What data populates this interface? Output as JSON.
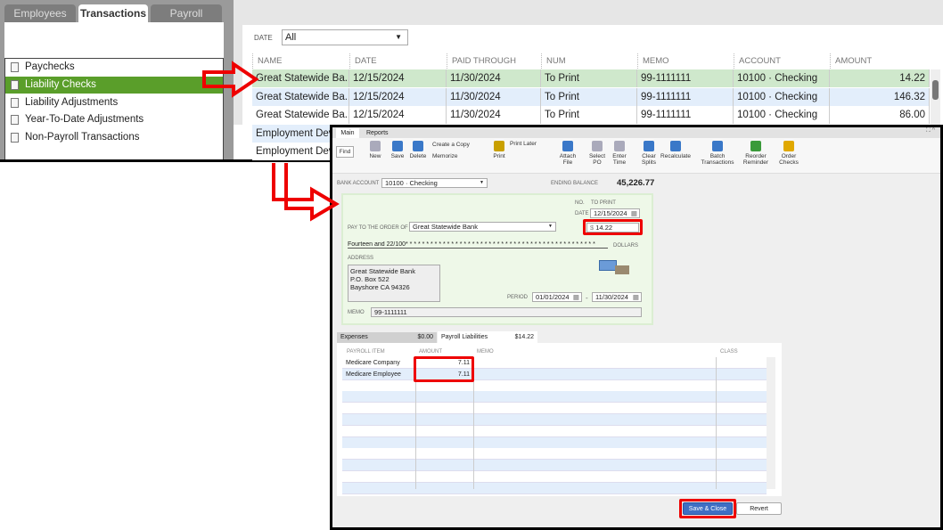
{
  "left": {
    "tabs": [
      "Employees",
      "Transactions",
      "Payroll"
    ],
    "items": [
      "Paychecks",
      "Liability Checks",
      "Liability Adjustments",
      "Year-To-Date Adjustments",
      "Non-Payroll Transactions"
    ]
  },
  "filter": {
    "label": "DATE",
    "value": "All"
  },
  "table": {
    "headers": [
      "NAME",
      "DATE",
      "PAID THROUGH",
      "NUM",
      "MEMO",
      "ACCOUNT",
      "AMOUNT"
    ],
    "rows": [
      [
        "Great Statewide Ba...",
        "12/15/2024",
        "11/30/2024",
        "To Print",
        "99-1111111",
        "10100 · Checking",
        "14.22"
      ],
      [
        "Great Statewide Ba...",
        "12/15/2024",
        "11/30/2024",
        "To Print",
        "99-1111111",
        "10100 · Checking",
        "146.32"
      ],
      [
        "Great Statewide Ba...",
        "12/15/2024",
        "11/30/2024",
        "To Print",
        "99-1111111",
        "10100 · Checking",
        "86.00"
      ],
      [
        "Employment Dev..."
      ],
      [
        "Employment Dev..."
      ]
    ]
  },
  "window": {
    "tabs": [
      "Main",
      "Reports"
    ],
    "toolbar": [
      "Find",
      "New",
      "Save",
      "Delete",
      "Create a Copy",
      "Memorize",
      "Print",
      "Print Later",
      "Attach File",
      "Select PO",
      "Enter Time",
      "Clear Splits",
      "Recalculate",
      "Batch Transactions",
      "Reorder Reminder",
      "Order Checks"
    ],
    "bank_account_label": "BANK ACCOUNT",
    "bank_account": "10100 · Checking",
    "ending_balance_label": "ENDING BALANCE",
    "ending_balance": "45,226.77",
    "check": {
      "no_label": "NO.",
      "no": "TO PRINT",
      "date_label": "DATE",
      "date": "12/15/2024",
      "payee_label": "PAY TO THE ORDER OF",
      "payee": "Great Statewide Bank",
      "currency": "$",
      "amount": "14.22",
      "words": "Fourteen and 22/100* * * * * * * * * * * * * * * * * * * * * * * * * * * * * * * * * * * * * * * * * * * * * *",
      "dollars": "DOLLARS",
      "address_label": "ADDRESS",
      "address": [
        "Great Statewide Bank",
        "P.O. Box 522",
        "Bayshore CA 94326"
      ],
      "period_label": "PERIOD",
      "period_from": "01/01/2024",
      "period_sep": "-",
      "period_to": "11/30/2024",
      "memo_label": "MEMO",
      "memo": "99-1111111"
    },
    "subtabs": [
      {
        "label": "Expenses",
        "amount": "$0.00"
      },
      {
        "label": "Payroll Liabilities",
        "amount": "$14.22"
      }
    ],
    "grid": {
      "headers": [
        "PAYROLL ITEM",
        "AMOUNT",
        "MEMO",
        "CLASS"
      ],
      "rows": [
        [
          "Medicare Company",
          "7.11"
        ],
        [
          "Medicare Employee",
          "7.11"
        ]
      ]
    },
    "save_close": "Save & Close",
    "revert": "Revert"
  }
}
